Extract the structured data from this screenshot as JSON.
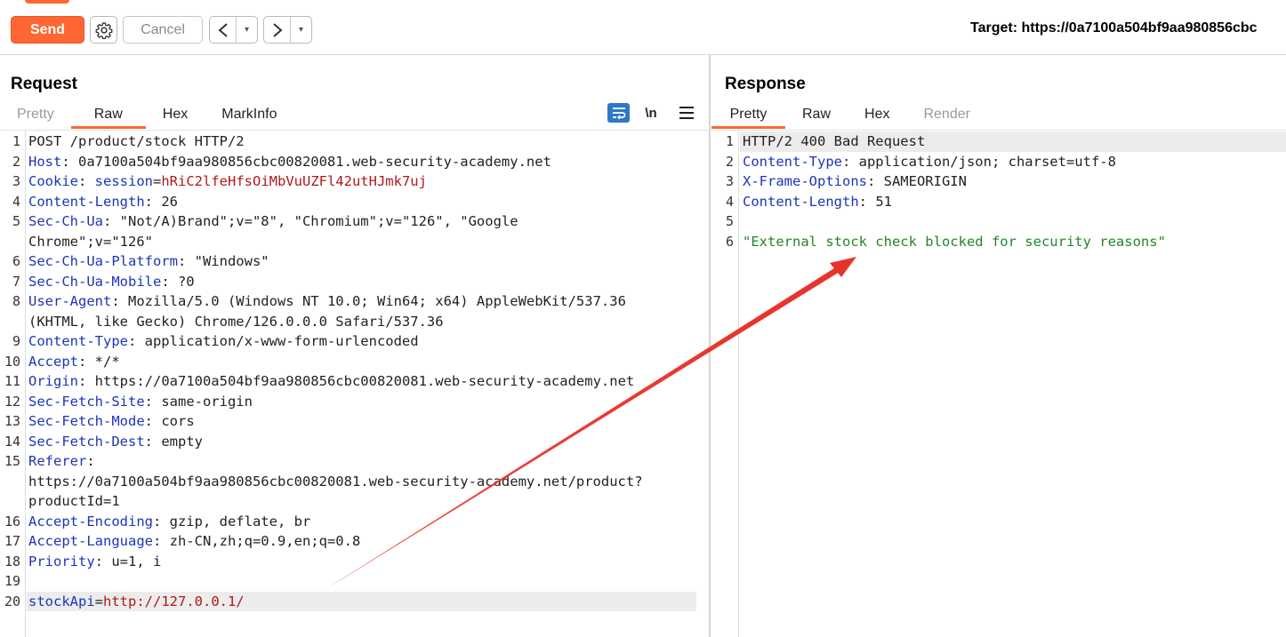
{
  "toolbar": {
    "send_label": "Send",
    "cancel_label": "Cancel",
    "back_glyph": "<",
    "fwd_glyph": ">",
    "dropdown_glyph": "▾",
    "target_label": "Target: https://0a7100a504bf9aa980856cbc"
  },
  "request": {
    "title": "Request",
    "tabs": [
      "Pretty",
      "Raw",
      "Hex",
      "MarkInfo"
    ],
    "active_tab": "Raw",
    "newline_label": "\\n",
    "lines": [
      {
        "n": "1",
        "k": "",
        "v": "POST /product/stock HTTP/2"
      },
      {
        "n": "2",
        "k": "Host",
        "v": ": 0a7100a504bf9aa980856cbc00820081.web-security-academy.net"
      },
      {
        "n": "3",
        "k": "Cookie",
        "v": ": ",
        "ck": "session",
        "cv": "hRiC2lfeHfsOiMbVuUZFl42utHJmk7uj"
      },
      {
        "n": "4",
        "k": "Content-Length",
        "v": ": 26"
      },
      {
        "n": "5",
        "k": "Sec-Ch-Ua",
        "v": ": \"Not/A)Brand\";v=\"8\", \"Chromium\";v=\"126\", \"Google"
      },
      {
        "n": "",
        "k": "",
        "v": "Chrome\";v=\"126\""
      },
      {
        "n": "6",
        "k": "Sec-Ch-Ua-Platform",
        "v": ": \"Windows\""
      },
      {
        "n": "7",
        "k": "Sec-Ch-Ua-Mobile",
        "v": ": ?0"
      },
      {
        "n": "8",
        "k": "User-Agent",
        "v": ": Mozilla/5.0 (Windows NT 10.0; Win64; x64) AppleWebKit/537.36"
      },
      {
        "n": "",
        "k": "",
        "v": "(KHTML, like Gecko) Chrome/126.0.0.0 Safari/537.36"
      },
      {
        "n": "9",
        "k": "Content-Type",
        "v": ": application/x-www-form-urlencoded"
      },
      {
        "n": "10",
        "k": "Accept",
        "v": ": */*"
      },
      {
        "n": "11",
        "k": "Origin",
        "v": ": https://0a7100a504bf9aa980856cbc00820081.web-security-academy.net"
      },
      {
        "n": "12",
        "k": "Sec-Fetch-Site",
        "v": ": same-origin"
      },
      {
        "n": "13",
        "k": "Sec-Fetch-Mode",
        "v": ": cors"
      },
      {
        "n": "14",
        "k": "Sec-Fetch-Dest",
        "v": ": empty"
      },
      {
        "n": "15",
        "k": "Referer",
        "v": ":"
      },
      {
        "n": "",
        "k": "",
        "v": "https://0a7100a504bf9aa980856cbc00820081.web-security-academy.net/product?"
      },
      {
        "n": "",
        "k": "",
        "v": "productId=1"
      },
      {
        "n": "16",
        "k": "Accept-Encoding",
        "v": ": gzip, deflate, br"
      },
      {
        "n": "17",
        "k": "Accept-Language",
        "v": ": zh-CN,zh;q=0.9,en;q=0.8"
      },
      {
        "n": "18",
        "k": "Priority",
        "v": ": u=1, i"
      },
      {
        "n": "19",
        "k": "",
        "v": ""
      },
      {
        "n": "20",
        "k": "stockApi",
        "v": "=",
        "cv": "http://127.0.0.1/",
        "hl": true
      }
    ]
  },
  "response": {
    "title": "Response",
    "tabs": [
      "Pretty",
      "Raw",
      "Hex",
      "Render"
    ],
    "active_tab": "Pretty",
    "lines": [
      {
        "n": "1",
        "k": "",
        "v": "HTTP/2 400 Bad Request",
        "hl": true
      },
      {
        "n": "2",
        "k": "Content-Type",
        "v": ": application/json; charset=utf-8"
      },
      {
        "n": "3",
        "k": "X-Frame-Options",
        "v": ": SAMEORIGIN"
      },
      {
        "n": "4",
        "k": "Content-Length",
        "v": ": 51"
      },
      {
        "n": "5",
        "k": "",
        "v": ""
      },
      {
        "n": "6",
        "k": "",
        "v": "",
        "str": "\"External stock check blocked for security reasons\""
      }
    ]
  },
  "colors": {
    "accent": "#ff6633",
    "header_key": "#1e35b8",
    "cookie_value": "#b01818",
    "json_string": "#22862a",
    "annotation_arrow": "#e8312a"
  }
}
